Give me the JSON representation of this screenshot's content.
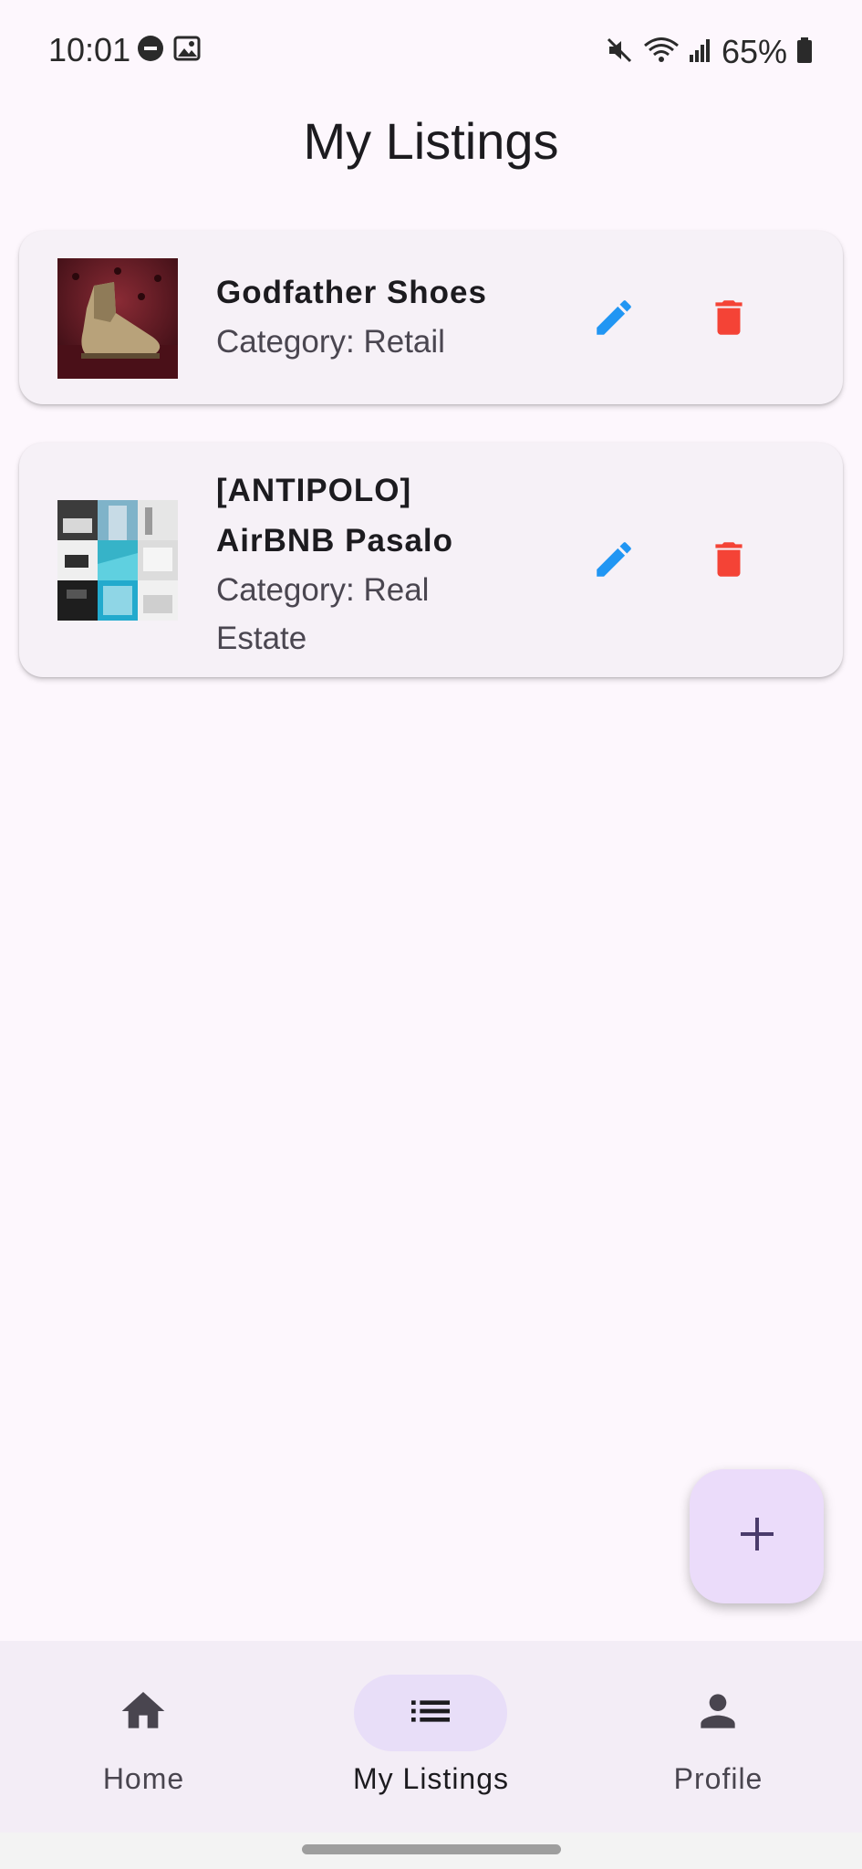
{
  "status_bar": {
    "time": "10:01",
    "battery": "65%",
    "icons": [
      "do-not-disturb-icon",
      "image-icon",
      "mute-icon",
      "wifi-icon",
      "signal-icon",
      "battery-icon"
    ]
  },
  "page": {
    "title": "My Listings"
  },
  "listings": [
    {
      "title_lines": [
        "Godfather Shoes"
      ],
      "category": "Category: Retail",
      "category_lines": [
        "Category: Retail"
      ],
      "image": "shoe-photo",
      "edit_icon": "edit-icon",
      "delete_icon": "delete-icon"
    },
    {
      "title_lines": [
        "[ANTIPOLO]",
        "AirBNB Pasalo"
      ],
      "category": "Category: Real Estate",
      "category_lines": [
        "Category: Real",
        "Estate"
      ],
      "image": "property-photo-collage",
      "edit_icon": "edit-icon",
      "delete_icon": "delete-icon"
    }
  ],
  "fab": {
    "icon": "add-icon"
  },
  "bottom_nav": {
    "items": [
      {
        "label": "Home",
        "icon": "home-icon",
        "selected": false
      },
      {
        "label": "My Listings",
        "icon": "list-icon",
        "selected": true
      },
      {
        "label": "Profile",
        "icon": "person-icon",
        "selected": false
      }
    ]
  },
  "colors": {
    "background": "#fdf7fd",
    "card": "#f6f1f7",
    "edit": "#2196f3",
    "delete": "#f44336",
    "fab": "#ebdcfa",
    "nav_indicator": "#e8def8",
    "nav_bar": "#f3edf6"
  }
}
